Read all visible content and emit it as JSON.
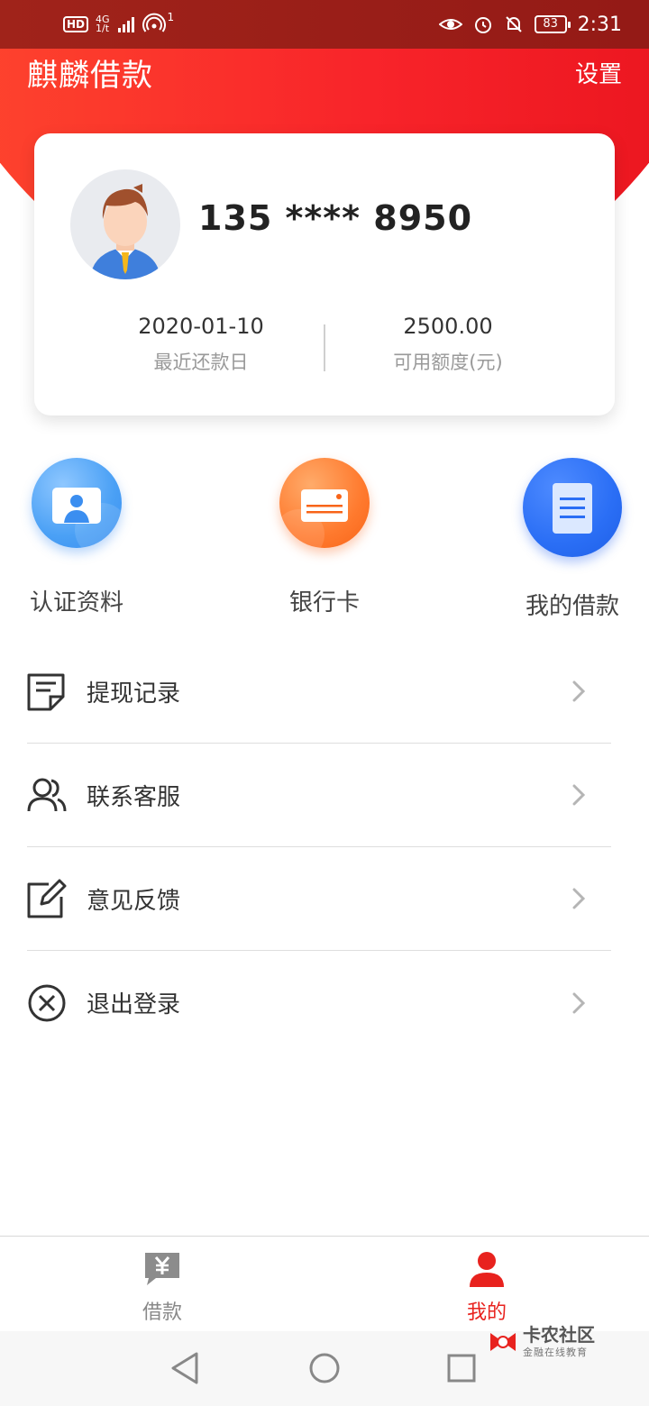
{
  "status_bar": {
    "hd": "HD",
    "net_top": "4G",
    "net_bottom": "1/t",
    "wifi_badge": "1",
    "battery": "83",
    "time": "2:31"
  },
  "header": {
    "title": "麒麟借款",
    "settings": "设置"
  },
  "profile": {
    "phone": "135 **** 8950",
    "recent_date": "2020-01-10",
    "recent_date_label": "最近还款日",
    "available_amount": "2500.00",
    "available_amount_label": "可用额度(元)"
  },
  "quick_actions": [
    {
      "label": "认证资料",
      "icon": "id-card-icon",
      "color": "#4aa0f5"
    },
    {
      "label": "银行卡",
      "icon": "bank-card-icon",
      "color": "#ff7a2e"
    },
    {
      "label": "我的借款",
      "icon": "document-icon",
      "color": "#2a6ef5"
    }
  ],
  "menu": [
    {
      "label": "提现记录",
      "icon": "record-icon"
    },
    {
      "label": "联系客服",
      "icon": "contacts-icon"
    },
    {
      "label": "意见反馈",
      "icon": "edit-icon"
    },
    {
      "label": "退出登录",
      "icon": "close-circle-icon"
    }
  ],
  "tabs": [
    {
      "label": "借款",
      "icon": "yen-chat-icon",
      "active": false
    },
    {
      "label": "我的",
      "icon": "person-icon",
      "active": true
    }
  ],
  "watermark": {
    "title": "卡农社区",
    "subtitle": "金融在线教育"
  },
  "colors": {
    "brand_red": "#f8242a",
    "active_tab": "#e8221e"
  }
}
